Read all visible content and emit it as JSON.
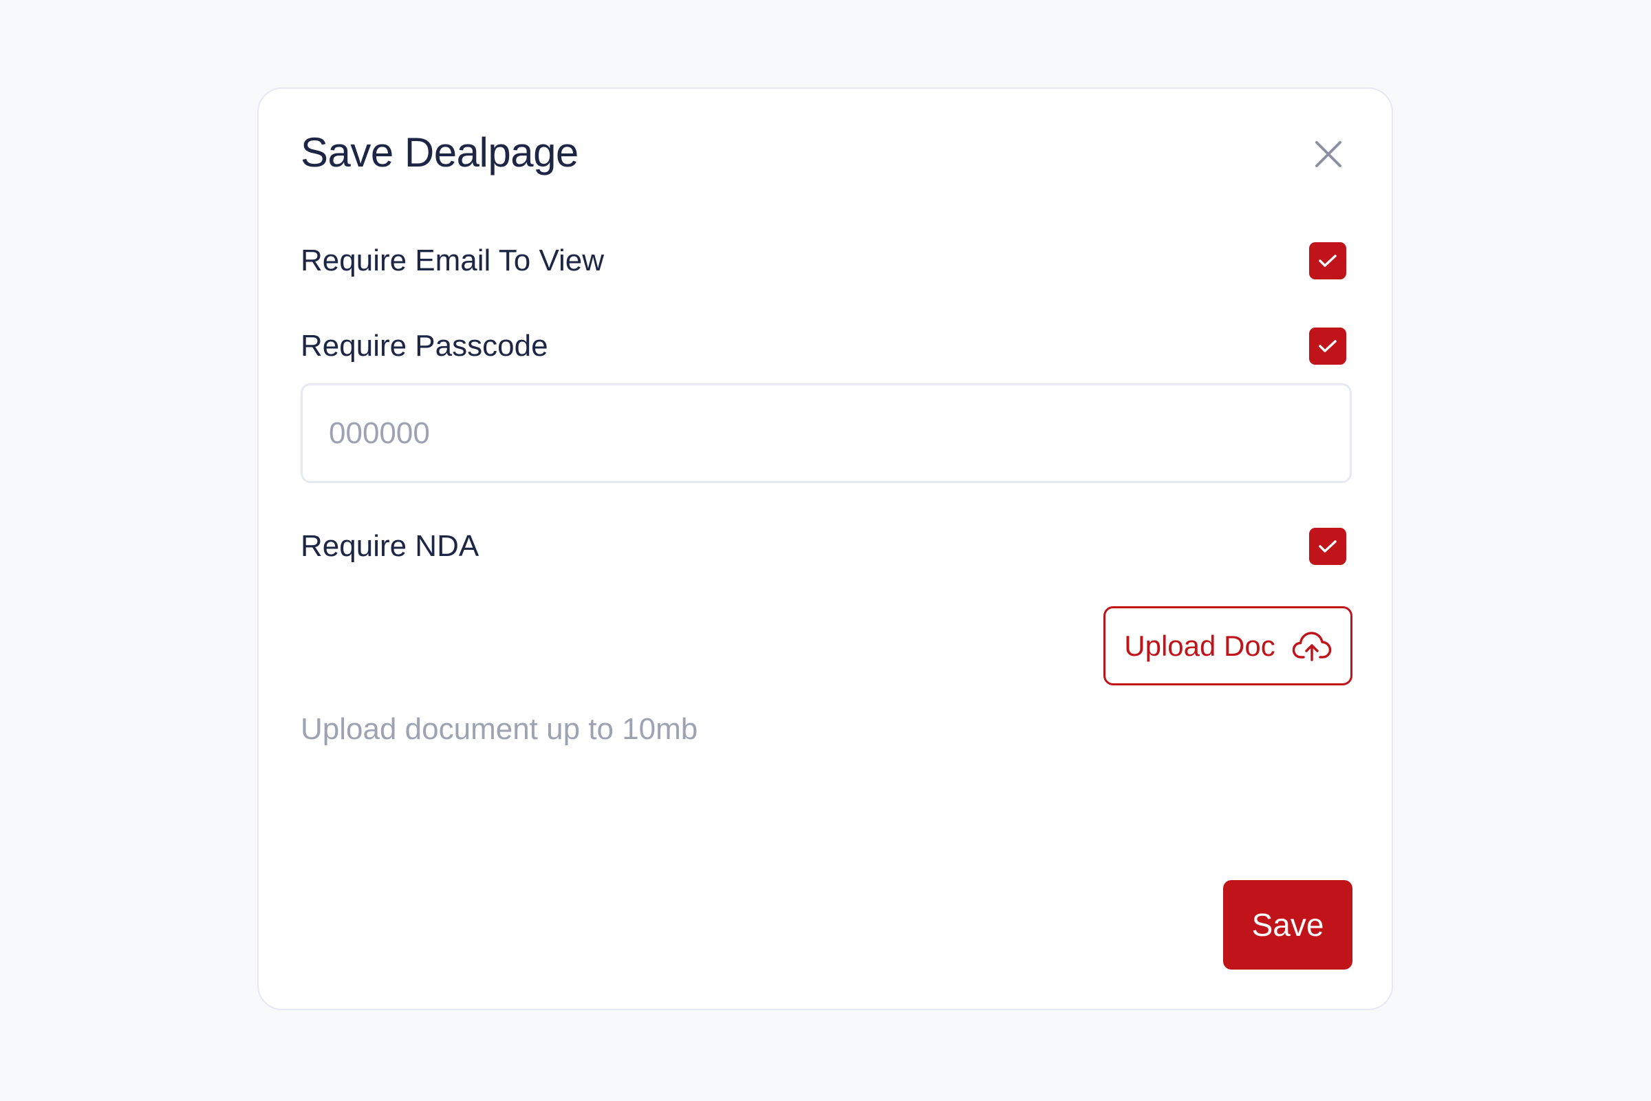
{
  "modal": {
    "title": "Save Dealpage",
    "close_icon": "close-icon"
  },
  "options": {
    "require_email": {
      "label": "Require Email To View",
      "checked": true
    },
    "require_passcode": {
      "label": "Require Passcode",
      "checked": true
    },
    "require_nda": {
      "label": "Require NDA",
      "checked": true
    }
  },
  "passcode": {
    "placeholder": "000000",
    "value": ""
  },
  "upload": {
    "hint": "Upload document up to 10mb",
    "button_label": "Upload Doc",
    "icon": "cloud-upload-icon"
  },
  "footer": {
    "save_label": "Save"
  },
  "colors": {
    "accent": "#c0141a",
    "text_primary": "#1d2645",
    "text_muted": "#9ea3b3",
    "border": "#e6e9f2",
    "background": "#f8f9fb"
  }
}
